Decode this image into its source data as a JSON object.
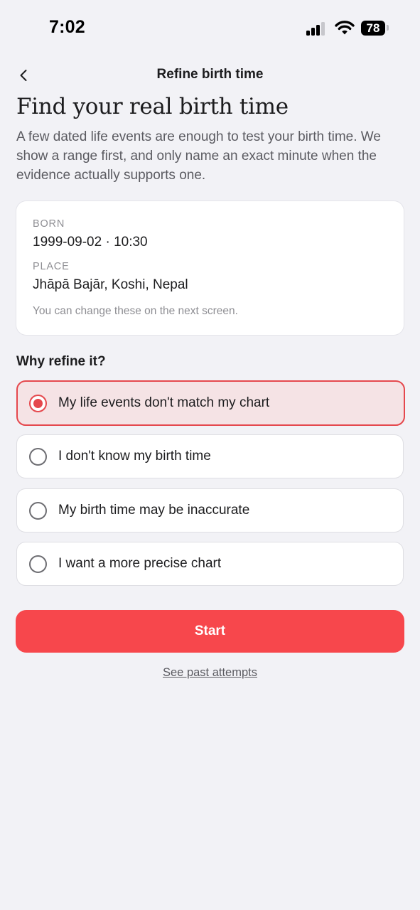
{
  "status_bar": {
    "time": "7:02",
    "battery": "78",
    "signal_icon": "cellular-signal-icon",
    "wifi_icon": "wifi-icon"
  },
  "nav": {
    "back_icon": "chevron-left-icon",
    "title": "Refine birth time"
  },
  "header": {
    "title": "Find your real birth time",
    "intro": "A few dated life events are enough to test your birth time. We show a range first, and only name an exact minute when the evidence actually supports one."
  },
  "card": {
    "born_label": "BORN",
    "born_value": "1999-09-02 · 10:30",
    "place_label": "PLACE",
    "place_value": "Jhāpā Bajār, Koshi, Nepal",
    "note": "You can change these on the next screen."
  },
  "reasons": {
    "title": "Why refine it?",
    "options": [
      {
        "label": "My life events don't match my chart",
        "selected": true
      },
      {
        "label": "I don't know my birth time",
        "selected": false
      },
      {
        "label": "My birth time may be inaccurate",
        "selected": false
      },
      {
        "label": "I want a more precise chart",
        "selected": false
      }
    ]
  },
  "actions": {
    "start_label": "Start",
    "past_attempts_label": "See past attempts"
  },
  "colors": {
    "accent": "#f7474c",
    "selected_border": "#e5484d",
    "selected_bg": "#f5e3e5",
    "background": "#f2f2f6"
  }
}
